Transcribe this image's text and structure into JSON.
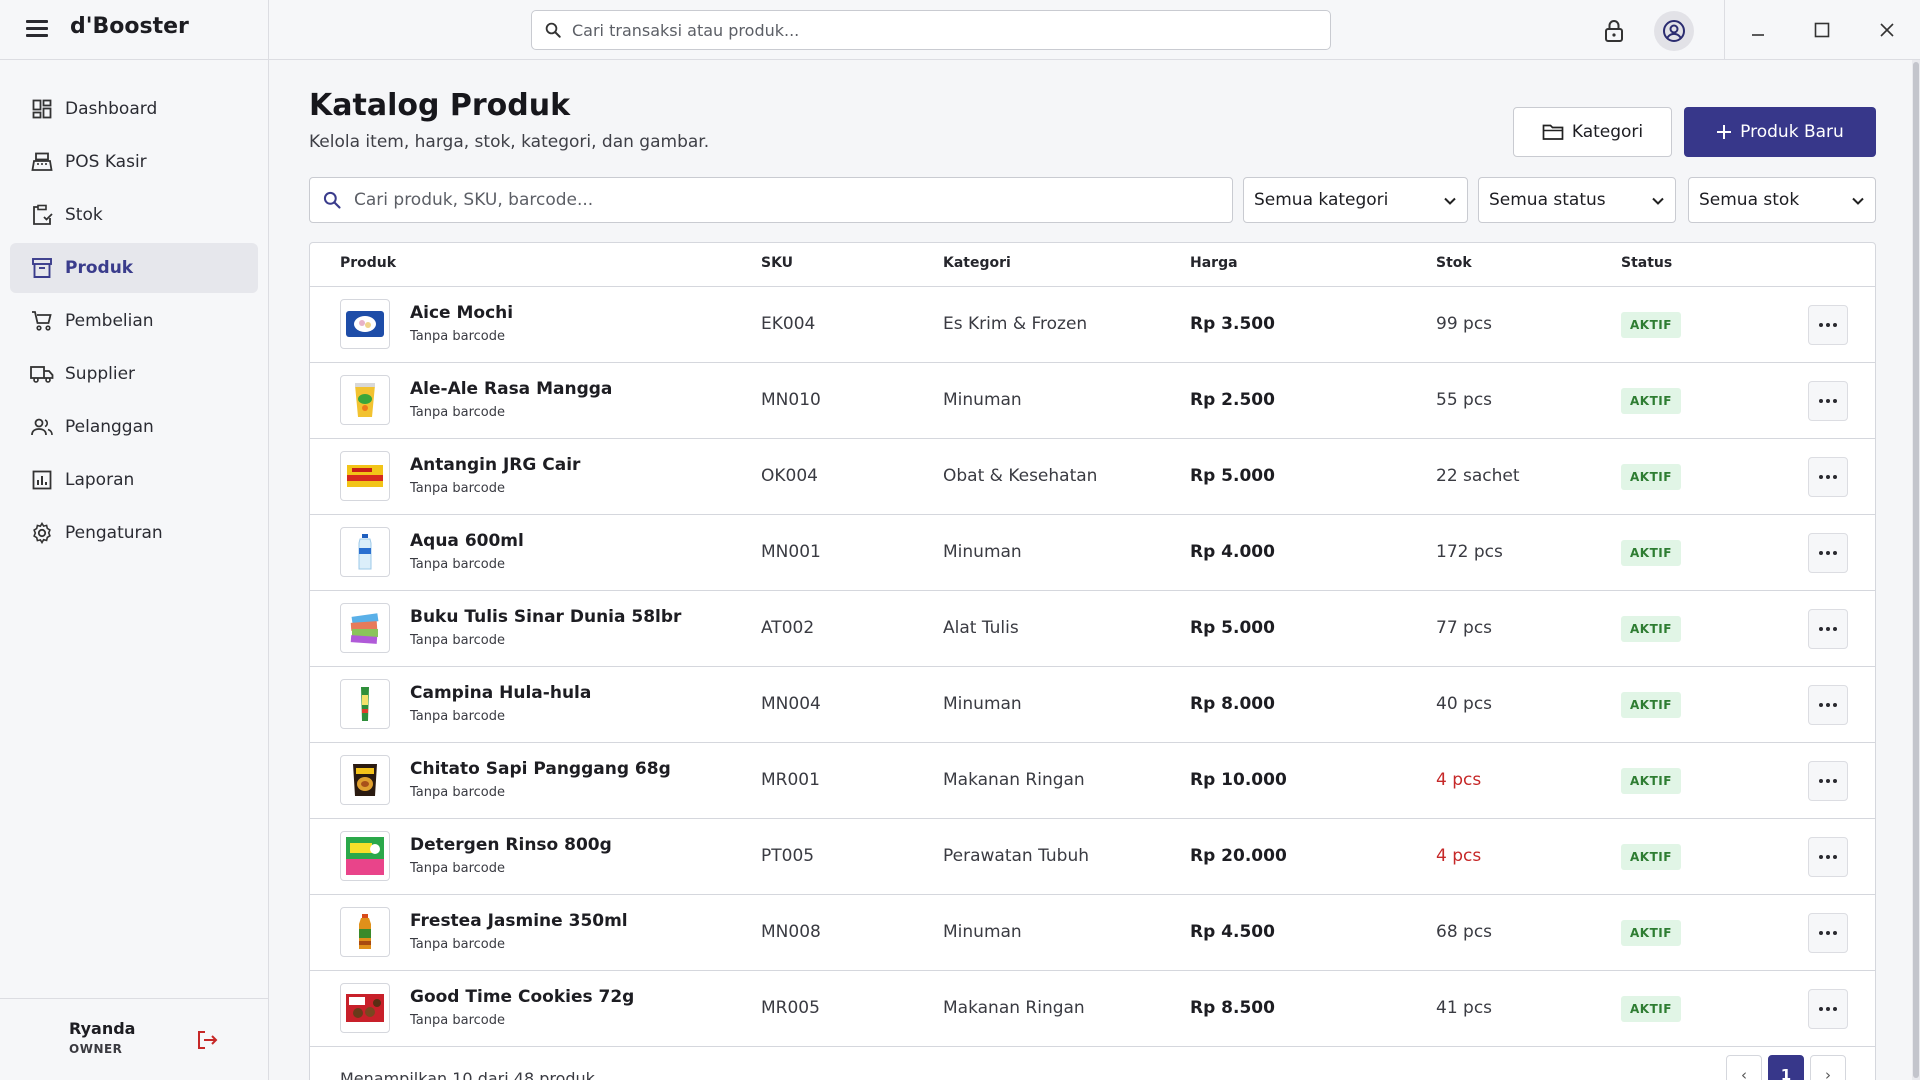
{
  "app": {
    "title": "d'Booster"
  },
  "topbar": {
    "search_placeholder": "Cari transaksi atau produk..."
  },
  "sidebar": {
    "items": [
      {
        "label": "Dashboard",
        "icon": "dashboard-icon"
      },
      {
        "label": "POS Kasir",
        "icon": "cash-register-icon"
      },
      {
        "label": "Stok",
        "icon": "inventory-icon"
      },
      {
        "label": "Produk",
        "icon": "product-box-icon",
        "active": true
      },
      {
        "label": "Pembelian",
        "icon": "cart-icon"
      },
      {
        "label": "Supplier",
        "icon": "truck-icon"
      },
      {
        "label": "Pelanggan",
        "icon": "people-icon"
      },
      {
        "label": "Laporan",
        "icon": "report-chart-icon"
      },
      {
        "label": "Pengaturan",
        "icon": "gear-icon"
      }
    ],
    "user": {
      "name": "Ryanda",
      "role": "OWNER"
    }
  },
  "page": {
    "title": "Katalog Produk",
    "subtitle": "Kelola item, harga, stok, kategori, dan gambar.",
    "btn_kategori": "Kategori",
    "btn_new": "Produk Baru",
    "search_placeholder": "Cari produk, SKU, barcode...",
    "filters": {
      "category": "Semua kategori",
      "status": "Semua status",
      "stock": "Semua stok"
    }
  },
  "table": {
    "headers": {
      "product": "Produk",
      "sku": "SKU",
      "category": "Kategori",
      "price": "Harga",
      "stock": "Stok",
      "status": "Status"
    },
    "rows": [
      {
        "name": "Aice Mochi",
        "barcode": "Tanpa barcode",
        "sku": "EK004",
        "category": "Es Krim & Frozen",
        "price": "Rp 3.500",
        "stock": "99 pcs",
        "status": "AKTIF"
      },
      {
        "name": "Ale-Ale Rasa Mangga",
        "barcode": "Tanpa barcode",
        "sku": "MN010",
        "category": "Minuman",
        "price": "Rp 2.500",
        "stock": "55 pcs",
        "status": "AKTIF"
      },
      {
        "name": "Antangin JRG Cair",
        "barcode": "Tanpa barcode",
        "sku": "OK004",
        "category": "Obat & Kesehatan",
        "price": "Rp 5.000",
        "stock": "22 sachet",
        "status": "AKTIF"
      },
      {
        "name": "Aqua 600ml",
        "barcode": "Tanpa barcode",
        "sku": "MN001",
        "category": "Minuman",
        "price": "Rp 4.000",
        "stock": "172 pcs",
        "status": "AKTIF"
      },
      {
        "name": "Buku Tulis Sinar Dunia 58lbr",
        "barcode": "Tanpa barcode",
        "sku": "AT002",
        "category": "Alat Tulis",
        "price": "Rp 5.000",
        "stock": "77 pcs",
        "status": "AKTIF"
      },
      {
        "name": "Campina Hula-hula",
        "barcode": "Tanpa barcode",
        "sku": "MN004",
        "category": "Minuman",
        "price": "Rp 8.000",
        "stock": "40 pcs",
        "status": "AKTIF"
      },
      {
        "name": "Chitato Sapi Panggang 68g",
        "barcode": "Tanpa barcode",
        "sku": "MR001",
        "category": "Makanan Ringan",
        "price": "Rp 10.000",
        "stock": "4 pcs",
        "status": "AKTIF"
      },
      {
        "name": "Detergen Rinso 800g",
        "barcode": "Tanpa barcode",
        "sku": "PT005",
        "category": "Perawatan Tubuh",
        "price": "Rp 20.000",
        "stock": "4 pcs",
        "status": "AKTIF"
      },
      {
        "name": "Frestea Jasmine 350ml",
        "barcode": "Tanpa barcode",
        "sku": "MN008",
        "category": "Minuman",
        "price": "Rp 4.500",
        "stock": "68 pcs",
        "status": "AKTIF"
      },
      {
        "name": "Good Time Cookies 72g",
        "barcode": "Tanpa barcode",
        "sku": "MR005",
        "category": "Makanan Ringan",
        "price": "Rp 8.500",
        "stock": "41 pcs",
        "status": "AKTIF"
      }
    ],
    "footer": "Menampilkan 10 dari 48 produk",
    "pagination": {
      "prev": "‹",
      "current": "1",
      "next": "›"
    }
  },
  "colors": {
    "accent": "#37378a",
    "active_badge_bg": "#e1f5e6",
    "active_badge_text": "#2e7d32",
    "low_stock": "#c62828"
  }
}
